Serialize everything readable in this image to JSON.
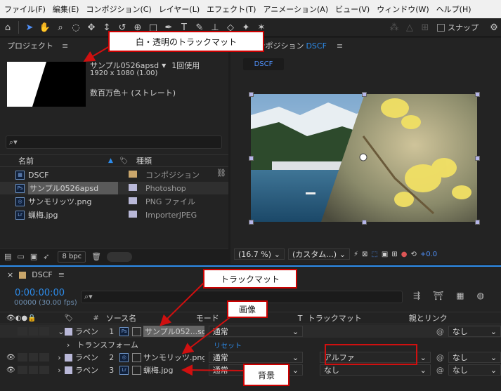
{
  "menu": [
    "ファイル(F)",
    "編集(E)",
    "コンポジション(C)",
    "レイヤー(L)",
    "エフェクト(T)",
    "アニメーション(A)",
    "ビュー(V)",
    "ウィンドウ(W)",
    "ヘルプ(H)"
  ],
  "toolbar": {
    "snap_label": "スナップ"
  },
  "callouts": {
    "matte": "白・透明のトラックマット",
    "trackmatte": "トラックマット",
    "image": "画像",
    "background": "背景"
  },
  "project": {
    "title": "プロジェクト",
    "selected_name": "サンプル0526apsd",
    "usage": "1回使用",
    "size": "1920 x 1080 (1.00)",
    "colors": "数百万色＋ (ストレート)",
    "col_name": "名前",
    "col_type": "種類",
    "items": [
      {
        "name": "DSCF",
        "type": "コンポジション",
        "color": "#c9a66b",
        "icon": "comp-icon"
      },
      {
        "name": "サンプル0526apsd",
        "type": "Photoshop",
        "color": "#b9b8d8",
        "icon": "psd-icon"
      },
      {
        "name": "サンモリッツ.png",
        "type": "PNG ファイル",
        "color": "#b9b8d8",
        "icon": "png-icon"
      },
      {
        "name": "蝋梅.jpg",
        "type": "ImporterJPEG",
        "color": "#b9b8d8",
        "icon": "lr-icon"
      }
    ],
    "bpc": "8 bpc"
  },
  "comp": {
    "title_prefix": "コンポジション",
    "title_name": "DSCF",
    "tab": "DSCF",
    "zoom": "(16.7 %)",
    "resolution": "(カスタム...)",
    "exposure": "+0.0"
  },
  "timeline": {
    "tab": "DSCF",
    "timecode": "0:00:00:00",
    "frames": "00000 (30.00 fps)",
    "col_source": "ソース名",
    "col_mode": "モード",
    "col_t": "T",
    "col_trackmatte": "トラックマット",
    "col_parent": "親とリンク",
    "transform": "トランスフォーム",
    "reset": "リセット",
    "layers": [
      {
        "label": "ラベン",
        "num": "1",
        "source": "サンプル052...sd",
        "mode": "通常",
        "trackmatte": "",
        "parent": "なし"
      },
      {
        "label": "ラベン",
        "num": "2",
        "source": "サンモリッツ.png",
        "mode": "通常",
        "trackmatte": "アルファ",
        "parent": "なし"
      },
      {
        "label": "ラベン",
        "num": "3",
        "source": "蝋梅.jpg",
        "mode": "通常",
        "trackmatte": "なし",
        "parent": "なし"
      }
    ]
  },
  "colors": {
    "accent": "#2d8ceb",
    "highlight_red": "#d01010"
  }
}
